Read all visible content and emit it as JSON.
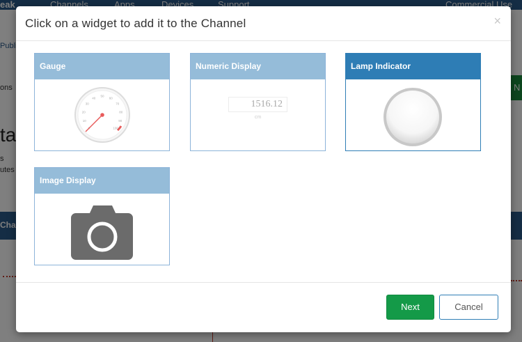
{
  "background": {
    "brand": "eak",
    "nav": [
      "Channels",
      "Apps",
      "Devices",
      "Support"
    ],
    "commercial": "Commercial Use",
    "fragments": {
      "publ": "Publi",
      "ons": "ons",
      "stat": "tat",
      "s": "s",
      "utes": "utes",
      "cha": "Cha",
      "n": "N"
    }
  },
  "modal": {
    "title": "Click on a widget to add it to the Channel",
    "close_symbol": "×",
    "widgets": [
      {
        "label": "Gauge"
      },
      {
        "label": "Numeric Display",
        "value": "1516.12",
        "unit": "cm"
      },
      {
        "label": "Lamp Indicator"
      },
      {
        "label": "Image Display"
      }
    ],
    "gauge_ticks": [
      "0",
      "10",
      "20",
      "30",
      "40",
      "50",
      "60",
      "70",
      "80",
      "90",
      "100"
    ],
    "footer": {
      "next_label": "Next",
      "cancel_label": "Cancel"
    }
  },
  "colors": {
    "header_inactive": "#95bcd9",
    "header_active": "#2e7db5",
    "next_button": "#149a48"
  }
}
